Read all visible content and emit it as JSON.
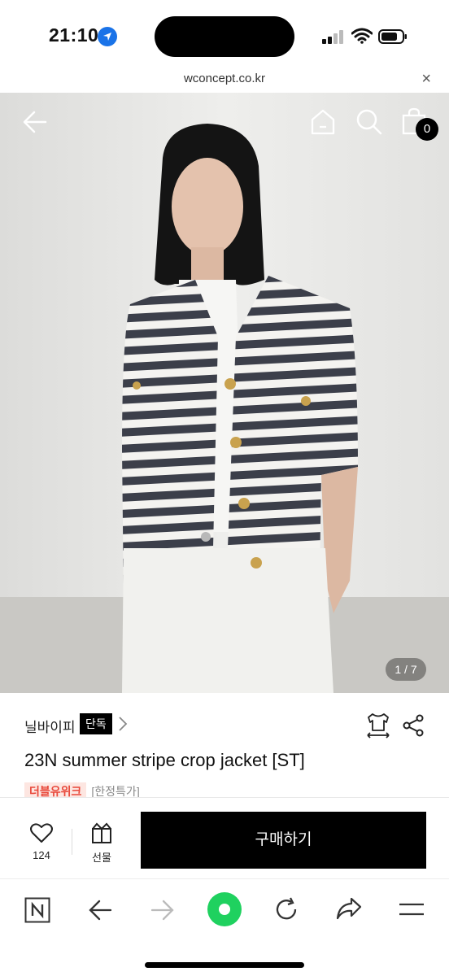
{
  "status_bar": {
    "time": "21:10"
  },
  "browser": {
    "url": "wconcept.co.kr",
    "close_label": "×"
  },
  "hero": {
    "cart_count": "0",
    "image_counter": "1 / 7"
  },
  "product": {
    "brand": "닐바이피",
    "exclusive_badge": "단독",
    "title": "23N summer stripe crop jacket [ST]",
    "promo_tag": "더블유위크",
    "promo_note": "[한정특가]"
  },
  "actions": {
    "like_count": "124",
    "gift_label": "선물",
    "buy_label": "구매하기"
  },
  "icons": {
    "back": "arrow-left-icon",
    "home": "home-icon",
    "search": "search-icon",
    "cart": "shopping-bag-icon",
    "size": "size-guide-icon",
    "share": "share-icon",
    "heart": "heart-icon",
    "gift": "gift-icon",
    "naver": "naver-n-icon",
    "nav_back": "arrow-left-icon",
    "nav_forward": "arrow-right-icon",
    "green_dot": "green-home-icon",
    "reload": "reload-icon",
    "nav_share": "share-arrow-icon",
    "menu": "menu-icon"
  },
  "colors": {
    "accent_green": "#1fd15f",
    "promo_red": "#e8483a",
    "buy_button": "#000000"
  }
}
